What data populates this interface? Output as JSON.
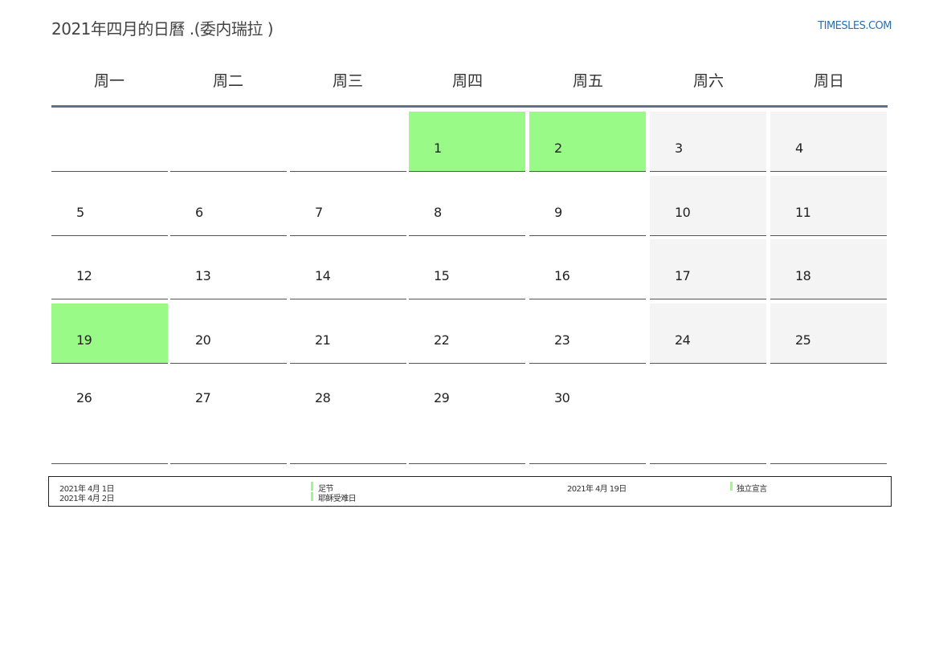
{
  "header": {
    "title": "2021年四月的日曆 .(委内瑞拉 )",
    "site": "TIMESLES.COM"
  },
  "weekdays": [
    "周一",
    "周二",
    "周三",
    "周四",
    "周五",
    "周六",
    "周日"
  ],
  "weeks": [
    [
      "",
      "",
      "",
      "1",
      "2",
      "3",
      "4"
    ],
    [
      "5",
      "6",
      "7",
      "8",
      "9",
      "10",
      "11"
    ],
    [
      "12",
      "13",
      "14",
      "15",
      "16",
      "17",
      "18"
    ],
    [
      "19",
      "20",
      "21",
      "22",
      "23",
      "24",
      "25"
    ],
    [
      "26",
      "27",
      "28",
      "29",
      "30",
      "",
      ""
    ]
  ],
  "highlighted_days": [
    "1",
    "2",
    "19"
  ],
  "colors": {
    "holiday": "#99fa88",
    "weekend": "#f4f4f4",
    "rule": "#5b7190",
    "link": "#2a6fb0"
  },
  "legend": [
    {
      "date": "2021年 4月 1日",
      "name": "足节"
    },
    {
      "date": "2021年 4月 2日",
      "name": "耶稣受难日"
    },
    {
      "date": "2021年 4月 19日",
      "name": "独立宣言"
    }
  ]
}
